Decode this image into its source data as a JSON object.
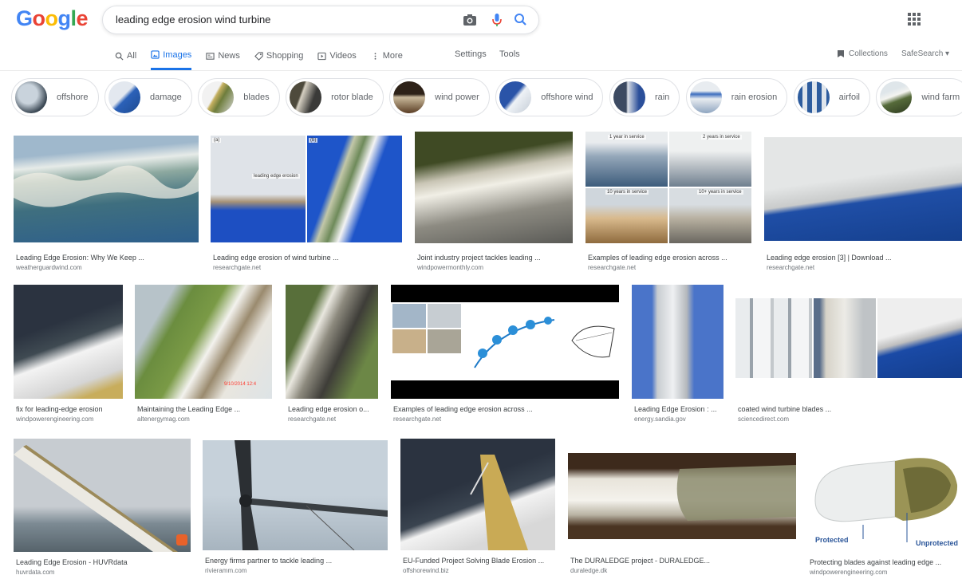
{
  "logo": [
    "G",
    "o",
    "o",
    "g",
    "l",
    "e"
  ],
  "search": {
    "query": "leading edge erosion wind turbine",
    "icons": [
      "camera-icon",
      "mic-icon",
      "search-icon"
    ]
  },
  "tabs": [
    {
      "label": "All",
      "icon": "search-icon"
    },
    {
      "label": "Images",
      "icon": "image-icon",
      "active": true
    },
    {
      "label": "News",
      "icon": "news-icon"
    },
    {
      "label": "Shopping",
      "icon": "tag-icon"
    },
    {
      "label": "Videos",
      "icon": "play-icon"
    },
    {
      "label": "More",
      "icon": "dots-icon"
    }
  ],
  "settings_label": "Settings",
  "tools_label": "Tools",
  "collections_label": "Collections",
  "safesearch_label": "SafeSearch ▾",
  "chips": [
    {
      "label": "offshore"
    },
    {
      "label": "damage"
    },
    {
      "label": "blades"
    },
    {
      "label": "rotor blade"
    },
    {
      "label": "wind power"
    },
    {
      "label": "offshore wind"
    },
    {
      "label": "rain"
    },
    {
      "label": "rain erosion"
    },
    {
      "label": "airfoil"
    },
    {
      "label": "wind farm"
    }
  ],
  "results": [
    {
      "title": "Leading Edge Erosion: Why We Keep ...",
      "source": "weatherguardwind.com"
    },
    {
      "title": "Leading edge erosion of wind turbine ...",
      "source": "researchgate.net"
    },
    {
      "title": "Joint industry project tackles leading ...",
      "source": "windpowermonthly.com"
    },
    {
      "title": "Examples of leading edge erosion across ...",
      "source": "researchgate.net"
    },
    {
      "title": "Leading edge erosion [3] | Download ...",
      "source": "researchgate.net"
    },
    {
      "title": "fix for leading-edge erosion",
      "source": "windpowerengineering.com"
    },
    {
      "title": "Maintaining the Leading Edge ...",
      "source": "altenergymag.com"
    },
    {
      "title": "Leading edge erosion o...",
      "source": "researchgate.net"
    },
    {
      "title": "Examples of leading edge erosion across ...",
      "source": "researchgate.net"
    },
    {
      "title": "Leading Edge Erosion : ...",
      "source": "energy.sandia.gov"
    },
    {
      "title": "coated wind turbine blades ...",
      "source": "sciencedirect.com"
    },
    {
      "title": "Leading Edge Erosion - HUVRdata",
      "source": "huvrdata.com"
    },
    {
      "title": "Energy firms partner to tackle leading ...",
      "source": "rivieramm.com"
    },
    {
      "title": "EU-Funded Project Solving Blade Erosion ...",
      "source": "offshorewind.biz"
    },
    {
      "title": "The DURALEDGE project - DURALEDGE...",
      "source": "duraledge.dk"
    },
    {
      "title": "Protecting blades against leading edge ...",
      "source": "windpowerengineering.com"
    }
  ],
  "image_labels": {
    "panel_a": "(a)",
    "panel_b": "(b)",
    "leading_edge_erosion": "leading edge erosion",
    "years_1": "1 year in service",
    "years_2": "2 years in service",
    "years_10": "10 years in service",
    "years_10plus": "10+ years in service",
    "timestamp": "9/10/2014 12:4",
    "protected": "Protected",
    "unprotected": "Unprotected"
  },
  "colors": {
    "accent": "#1a73e8",
    "sky": "#2a5cb8"
  }
}
